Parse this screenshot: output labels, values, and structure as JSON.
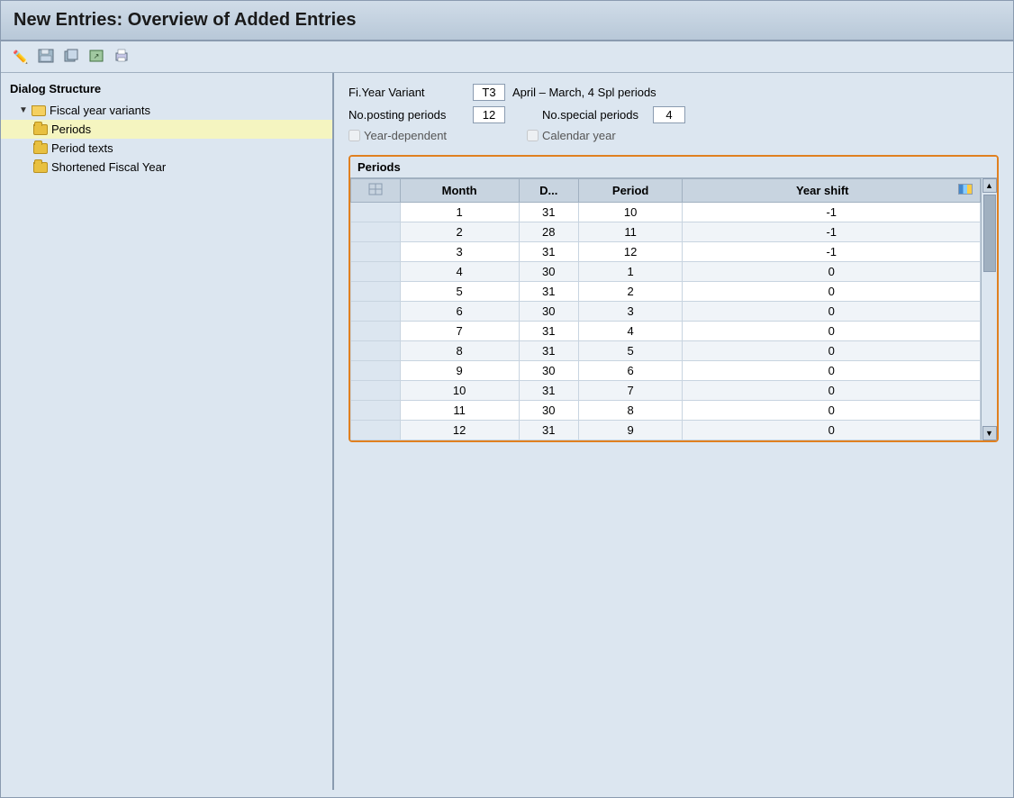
{
  "title": "New Entries: Overview of Added Entries",
  "toolbar": {
    "buttons": [
      {
        "name": "edit-icon",
        "symbol": "✏"
      },
      {
        "name": "save-icon",
        "symbol": "💾"
      },
      {
        "name": "save2-icon",
        "symbol": "📋"
      },
      {
        "name": "export-icon",
        "symbol": "📤"
      },
      {
        "name": "print-icon",
        "symbol": "🖨"
      }
    ]
  },
  "sidebar": {
    "title": "Dialog Structure",
    "items": [
      {
        "id": "fiscal-year-variants",
        "label": "Fiscal year variants",
        "level": 1,
        "type": "folder-open",
        "expanded": true
      },
      {
        "id": "periods",
        "label": "Periods",
        "level": 2,
        "type": "folder",
        "selected": true
      },
      {
        "id": "period-texts",
        "label": "Period texts",
        "level": 2,
        "type": "folder",
        "selected": false
      },
      {
        "id": "shortened-fiscal-year",
        "label": "Shortened Fiscal Year",
        "level": 2,
        "type": "folder",
        "selected": false
      }
    ]
  },
  "form": {
    "fi_year_variant_label": "Fi.Year Variant",
    "fi_year_variant_value": "T3",
    "fi_year_variant_desc": "April – March, 4 Spl periods",
    "no_posting_periods_label": "No.posting periods",
    "no_posting_periods_value": "12",
    "no_special_periods_label": "No.special periods",
    "no_special_periods_value": "4",
    "year_dependent_label": "Year-dependent",
    "calendar_year_label": "Calendar year"
  },
  "periods_table": {
    "title": "Periods",
    "columns": [
      "",
      "Month",
      "D...",
      "Period",
      "Year shift"
    ],
    "rows": [
      {
        "row_num": "",
        "month": "1",
        "day": "31",
        "period": "10",
        "year_shift": "-1"
      },
      {
        "row_num": "",
        "month": "2",
        "day": "28",
        "period": "11",
        "year_shift": "-1"
      },
      {
        "row_num": "",
        "month": "3",
        "day": "31",
        "period": "12",
        "year_shift": "-1"
      },
      {
        "row_num": "",
        "month": "4",
        "day": "30",
        "period": "1",
        "year_shift": "0"
      },
      {
        "row_num": "",
        "month": "5",
        "day": "31",
        "period": "2",
        "year_shift": "0"
      },
      {
        "row_num": "",
        "month": "6",
        "day": "30",
        "period": "3",
        "year_shift": "0"
      },
      {
        "row_num": "",
        "month": "7",
        "day": "31",
        "period": "4",
        "year_shift": "0"
      },
      {
        "row_num": "",
        "month": "8",
        "day": "31",
        "period": "5",
        "year_shift": "0"
      },
      {
        "row_num": "",
        "month": "9",
        "day": "30",
        "period": "6",
        "year_shift": "0"
      },
      {
        "row_num": "",
        "month": "10",
        "day": "31",
        "period": "7",
        "year_shift": "0"
      },
      {
        "row_num": "",
        "month": "11",
        "day": "30",
        "period": "8",
        "year_shift": "0"
      },
      {
        "row_num": "",
        "month": "12",
        "day": "31",
        "period": "9",
        "year_shift": "0"
      }
    ]
  }
}
